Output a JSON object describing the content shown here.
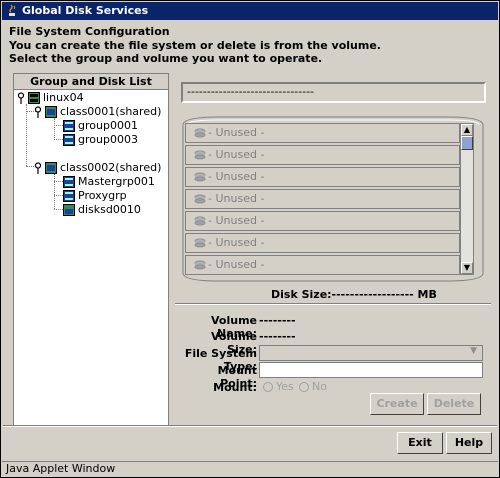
{
  "window": {
    "title": "Global Disk Services"
  },
  "header": {
    "line1": "File System Configuration",
    "line2": "You can create the file system or delete is from the volume.",
    "line3": "Select the group and volume you want to operate."
  },
  "group_list": {
    "title": "Group and Disk List",
    "nodes": [
      {
        "label": "linux04"
      },
      {
        "label": "class0001(shared)"
      },
      {
        "label": "group0001"
      },
      {
        "label": "group0003"
      },
      {
        "label": "class0002(shared)"
      },
      {
        "label": "Mastergrp001"
      },
      {
        "label": "Proxygrp"
      },
      {
        "label": "disksd0010"
      }
    ]
  },
  "volume_selector": {
    "value": "--------------------------------"
  },
  "disk_slots": [
    {
      "label": "- Unused -"
    },
    {
      "label": "- Unused -"
    },
    {
      "label": "- Unused -"
    },
    {
      "label": "- Unused -"
    },
    {
      "label": "- Unused -"
    },
    {
      "label": "- Unused -"
    },
    {
      "label": "- Unused -"
    }
  ],
  "disk_size": {
    "label": "Disk Size:------------------ MB"
  },
  "volume_info": {
    "name_label": "Volume Name:",
    "name_value": "--------",
    "size_label": "Volume Size:",
    "size_value": "--------",
    "fstype_label": "File System Type:",
    "mount_point_label": "Mount Point:",
    "mount_label": "Mount:",
    "mount_yes": "Yes",
    "mount_no": "No"
  },
  "actions": {
    "create": "Create",
    "delete": "Delete",
    "exit": "Exit",
    "help": "Help"
  },
  "status_bar": {
    "text": "Java Applet Window"
  },
  "colors": {
    "titlebar": "#0a246a",
    "face": "#d4d0c8",
    "disabled_text": "#808080"
  }
}
